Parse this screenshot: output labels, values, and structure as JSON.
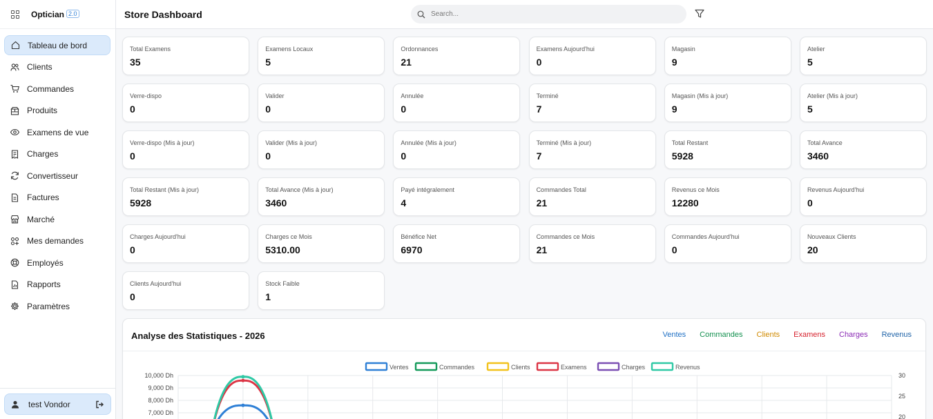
{
  "brand": {
    "name": "Optician",
    "version": "2.0"
  },
  "sidebar": {
    "items": [
      {
        "label": "Tableau de bord",
        "icon": "home-icon",
        "active": true
      },
      {
        "label": "Clients",
        "icon": "users-icon"
      },
      {
        "label": "Commandes",
        "icon": "cart-icon"
      },
      {
        "label": "Produits",
        "icon": "box-icon"
      },
      {
        "label": "Examens de vue",
        "icon": "eye-icon"
      },
      {
        "label": "Charges",
        "icon": "receipt-icon"
      },
      {
        "label": "Convertisseur",
        "icon": "refresh-icon"
      },
      {
        "label": "Factures",
        "icon": "document-icon"
      },
      {
        "label": "Marché",
        "icon": "store-icon"
      },
      {
        "label": "Mes demandes",
        "icon": "grid-plus-icon"
      },
      {
        "label": "Employés",
        "icon": "lifebuoy-icon"
      },
      {
        "label": "Rapports",
        "icon": "report-icon"
      },
      {
        "label": "Paramètres",
        "icon": "gear-icon"
      }
    ],
    "user": {
      "name": "test Vondor"
    }
  },
  "header": {
    "title": "Store Dashboard",
    "search_placeholder": "Search..."
  },
  "cards": [
    {
      "label": "Total Examens",
      "value": "35"
    },
    {
      "label": "Examens Locaux",
      "value": "5"
    },
    {
      "label": "Ordonnances",
      "value": "21"
    },
    {
      "label": "Examens Aujourd'hui",
      "value": "0"
    },
    {
      "label": "Magasin",
      "value": "9"
    },
    {
      "label": "Atelier",
      "value": "5"
    },
    {
      "label": "Verre-dispo",
      "value": "0"
    },
    {
      "label": "Valider",
      "value": "0"
    },
    {
      "label": "Annulée",
      "value": "0"
    },
    {
      "label": "Terminé",
      "value": "7"
    },
    {
      "label": "Magasin (Mis à jour)",
      "value": "9"
    },
    {
      "label": "Atelier (Mis à jour)",
      "value": "5"
    },
    {
      "label": "Verre-dispo (Mis à jour)",
      "value": "0"
    },
    {
      "label": "Valider (Mis à jour)",
      "value": "0"
    },
    {
      "label": "Annulée (Mis à jour)",
      "value": "0"
    },
    {
      "label": "Terminé (Mis à jour)",
      "value": "7"
    },
    {
      "label": "Total Restant",
      "value": "5928"
    },
    {
      "label": "Total Avance",
      "value": "3460"
    },
    {
      "label": "Total Restant (Mis à jour)",
      "value": "5928"
    },
    {
      "label": "Total Avance (Mis à jour)",
      "value": "3460"
    },
    {
      "label": "Payé intégralement",
      "value": "4"
    },
    {
      "label": "Commandes Total",
      "value": "21"
    },
    {
      "label": "Revenus ce Mois",
      "value": "12280"
    },
    {
      "label": "Revenus Aujourd'hui",
      "value": "0"
    },
    {
      "label": "Charges Aujourd'hui",
      "value": "0"
    },
    {
      "label": "Charges ce Mois",
      "value": "5310.00"
    },
    {
      "label": "Bénéfice Net",
      "value": "6970"
    },
    {
      "label": "Commandes ce Mois",
      "value": "21"
    },
    {
      "label": "Commandes Aujourd'hui",
      "value": "0"
    },
    {
      "label": "Nouveaux Clients",
      "value": "20"
    },
    {
      "label": "Clients Aujourd'hui",
      "value": "0"
    },
    {
      "label": "Stock Faible",
      "value": "1"
    }
  ],
  "stats": {
    "title": "Analyse des Statistiques - 2026",
    "tabs": [
      {
        "label": "Ventes",
        "color": "#1e6fc4"
      },
      {
        "label": "Commandes",
        "color": "#13904f"
      },
      {
        "label": "Clients",
        "color": "#d08a00"
      },
      {
        "label": "Examens",
        "color": "#d6222e"
      },
      {
        "label": "Charges",
        "color": "#8b2bb5"
      },
      {
        "label": "Revenus",
        "color": "#1f63a8"
      }
    ]
  },
  "chart_data": {
    "type": "line",
    "legend": "top",
    "series": [
      {
        "name": "Ventes",
        "color": "#2f80d6",
        "axis": "left",
        "values": [
          7600,
          null
        ]
      },
      {
        "name": "Commandes",
        "color": "#149a5a",
        "axis": "right",
        "values": [
          null,
          null
        ]
      },
      {
        "name": "Clients",
        "color": "#f2c21c",
        "axis": "right",
        "values": [
          null,
          null
        ]
      },
      {
        "name": "Examens",
        "color": "#dc3545",
        "axis": "left",
        "values": [
          9600,
          null
        ]
      },
      {
        "name": "Charges",
        "color": "#7b4fb3",
        "axis": "left",
        "values": [
          null,
          null
        ]
      },
      {
        "name": "Revenus",
        "color": "#2ec9a5",
        "axis": "left",
        "values": [
          9900,
          null
        ]
      }
    ],
    "y_left": {
      "ticks": [
        "10,000 Dh",
        "9,000 Dh",
        "8,000 Dh",
        "7,000 Dh"
      ],
      "min": 7000,
      "max": 10000
    },
    "y_right": {
      "ticks": [
        "30",
        "25",
        "20"
      ],
      "min": 20,
      "max": 30
    },
    "grid": true
  }
}
